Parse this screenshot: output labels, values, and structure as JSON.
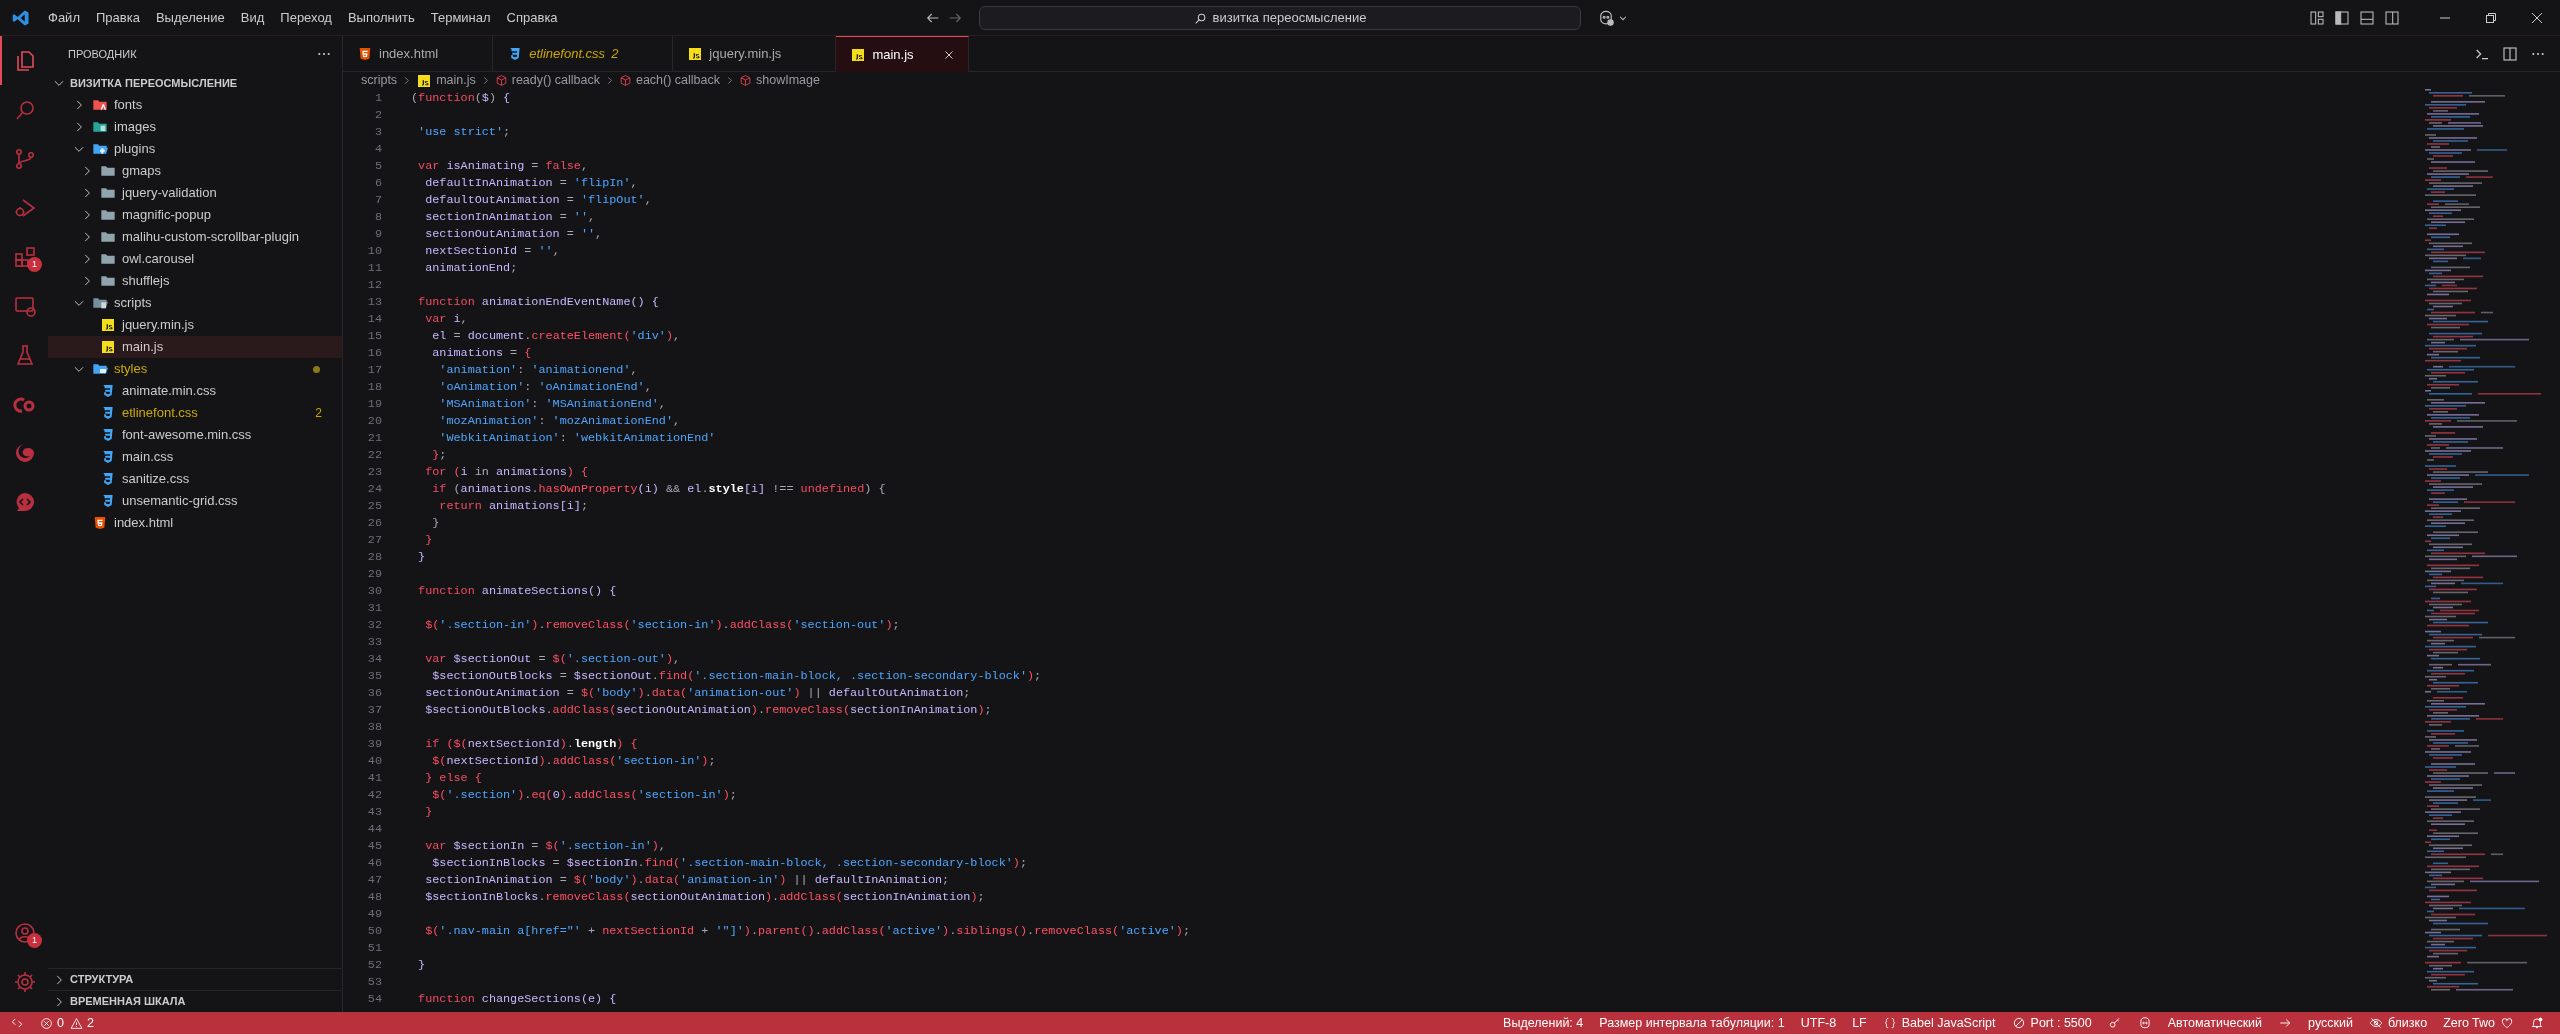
{
  "menu": [
    "Файл",
    "Правка",
    "Выделение",
    "Вид",
    "Переход",
    "Выполнить",
    "Терминал",
    "Справка"
  ],
  "search": {
    "value": "визитка переосмысление"
  },
  "activity_bar": [
    {
      "kind": "explorer",
      "selected": true
    },
    {
      "kind": "search",
      "selected": false
    },
    {
      "kind": "source-control",
      "selected": false
    },
    {
      "kind": "run-debug",
      "selected": false
    },
    {
      "kind": "extensions",
      "selected": false,
      "badge": "1"
    },
    {
      "kind": "remote",
      "selected": false
    },
    {
      "kind": "testing",
      "selected": false
    },
    {
      "kind": "cloud",
      "selected": false
    },
    {
      "kind": "edge",
      "selected": false
    },
    {
      "kind": "chat",
      "selected": false
    }
  ],
  "activity_bar_bottom": [
    {
      "kind": "account",
      "badge": "1"
    },
    {
      "kind": "settings"
    }
  ],
  "explorer": {
    "title": "ПРОВОДНИК",
    "root": {
      "label": "ВИЗИТКА ПЕРЕОСМЫСЛЕНИЕ",
      "expanded": true
    },
    "items": [
      {
        "label": "fonts",
        "kind": "folder-fonts",
        "expanded": false,
        "selected": false
      },
      {
        "label": "images",
        "kind": "folder-images",
        "expanded": false,
        "selected": false
      },
      {
        "label": "plugins",
        "kind": "folder-plugins",
        "expanded": true,
        "selected": false,
        "children": [
          {
            "label": "gmaps",
            "kind": "folder",
            "expanded": false,
            "selected": false
          },
          {
            "label": "jquery-validation",
            "kind": "folder",
            "expanded": false,
            "selected": false
          },
          {
            "label": "magnific-popup",
            "kind": "folder",
            "expanded": false,
            "selected": false
          },
          {
            "label": "malihu-custom-scrollbar-plugin",
            "kind": "folder",
            "expanded": false,
            "selected": false
          },
          {
            "label": "owl.carousel",
            "kind": "folder",
            "expanded": false,
            "selected": false
          },
          {
            "label": "shufflejs",
            "kind": "folder",
            "expanded": false,
            "selected": false
          }
        ]
      },
      {
        "label": "scripts",
        "kind": "folder-scripts",
        "expanded": true,
        "selected": false,
        "children": [
          {
            "label": "jquery.min.js",
            "kind": "js",
            "selected": false
          },
          {
            "label": "main.js",
            "kind": "js",
            "selected": true
          }
        ]
      },
      {
        "label": "styles",
        "kind": "folder-styles",
        "expanded": true,
        "selected": false,
        "warning": true,
        "children": [
          {
            "label": "animate.min.css",
            "kind": "css",
            "selected": false
          },
          {
            "label": "etlinefont.css",
            "kind": "css",
            "selected": false,
            "warning": true,
            "badge": "2"
          },
          {
            "label": "font-awesome.min.css",
            "kind": "css",
            "selected": false
          },
          {
            "label": "main.css",
            "kind": "css",
            "selected": false
          },
          {
            "label": "sanitize.css",
            "kind": "css",
            "selected": false
          },
          {
            "label": "unsemantic-grid.css",
            "kind": "css",
            "selected": false
          }
        ]
      },
      {
        "label": "index.html",
        "kind": "html",
        "selected": false
      }
    ]
  },
  "panels": [
    {
      "label": "СТРУКТУРА",
      "expanded": false
    },
    {
      "label": "ВРЕМЕННАЯ ШКАЛА",
      "expanded": false
    }
  ],
  "tabs": [
    {
      "label": "index.html",
      "kind": "html",
      "selected": false
    },
    {
      "label": "etlinefont.css",
      "kind": "css",
      "selected": false,
      "preview": true,
      "warning": true,
      "badge": "2"
    },
    {
      "label": "jquery.min.js",
      "kind": "js",
      "selected": false
    },
    {
      "label": "main.js",
      "kind": "js",
      "selected": true
    }
  ],
  "breadcrumbs": [
    {
      "label": "scripts",
      "kind": "folder"
    },
    {
      "label": "main.js",
      "kind": "js"
    },
    {
      "label": "ready() callback",
      "kind": "symbol"
    },
    {
      "label": "each() callback",
      "kind": "symbol"
    },
    {
      "label": "showImage",
      "kind": "symbol"
    }
  ],
  "code": [
    {
      "number": "1",
      "tokens": [
        {
          "text": "(",
          "kind": "p"
        },
        {
          "text": "function",
          "kind": "kw"
        },
        {
          "text": "(",
          "kind": "p"
        },
        {
          "text": "$",
          "kind": "id"
        },
        {
          "text": ")",
          "kind": "p"
        },
        {
          "text": " {",
          "kind": "br"
        }
      ]
    },
    {
      "number": "2"
    },
    {
      "number": "3",
      "tokens": [
        {
          "text": " 'use strict'",
          "kind": "str"
        },
        {
          "text": ";",
          "kind": "p"
        }
      ]
    },
    {
      "number": "4"
    },
    {
      "number": "5",
      "tokens": [
        {
          "text": " var",
          "kind": "kw"
        },
        {
          "text": " isAnimating",
          "kind": "id"
        },
        {
          "text": " =",
          "kind": "p"
        },
        {
          "text": " false",
          "kind": "lit"
        },
        {
          "text": ",",
          "kind": "p"
        }
      ]
    },
    {
      "number": "6",
      "tokens": [
        {
          "text": "  defaultInAnimation",
          "kind": "id"
        },
        {
          "text": " =",
          "kind": "p"
        },
        {
          "text": " 'flipIn'",
          "kind": "str"
        },
        {
          "text": ",",
          "kind": "p"
        }
      ]
    },
    {
      "number": "7",
      "tokens": [
        {
          "text": "  defaultOutAnimation",
          "kind": "id"
        },
        {
          "text": " =",
          "kind": "p"
        },
        {
          "text": " 'flipOut'",
          "kind": "str"
        },
        {
          "text": ",",
          "kind": "p"
        }
      ]
    },
    {
      "number": "8",
      "tokens": [
        {
          "text": "  sectionInAnimation",
          "kind": "id"
        },
        {
          "text": " =",
          "kind": "p"
        },
        {
          "text": " ''",
          "kind": "str"
        },
        {
          "text": ",",
          "kind": "p"
        }
      ]
    },
    {
      "number": "9",
      "tokens": [
        {
          "text": "  sectionOutAnimation",
          "kind": "id"
        },
        {
          "text": " =",
          "kind": "p"
        },
        {
          "text": " ''",
          "kind": "str"
        },
        {
          "text": ",",
          "kind": "p"
        }
      ]
    },
    {
      "number": "10",
      "tokens": [
        {
          "text": "  nextSectionId",
          "kind": "id"
        },
        {
          "text": " =",
          "kind": "p"
        },
        {
          "text": " ''",
          "kind": "str"
        },
        {
          "text": ",",
          "kind": "p"
        }
      ]
    },
    {
      "number": "11",
      "tokens": [
        {
          "text": "  animationEnd",
          "kind": "id"
        },
        {
          "text": ";",
          "kind": "p"
        }
      ]
    },
    {
      "number": "12"
    },
    {
      "number": "13",
      "tokens": [
        {
          "text": " function",
          "kind": "kw"
        },
        {
          "text": " animationEndEventName",
          "kind": "id"
        },
        {
          "text": "()",
          "kind": "br"
        },
        {
          "text": " {",
          "kind": "br"
        }
      ]
    },
    {
      "number": "14",
      "tokens": [
        {
          "text": "  var",
          "kind": "kw"
        },
        {
          "text": " i",
          "kind": "id"
        },
        {
          "text": ",",
          "kind": "p"
        }
      ]
    },
    {
      "number": "15",
      "tokens": [
        {
          "text": "   el",
          "kind": "id"
        },
        {
          "text": " =",
          "kind": "p"
        },
        {
          "text": " document",
          "kind": "id"
        },
        {
          "text": ".",
          "kind": "p"
        },
        {
          "text": "createElement",
          "kind": "fn"
        },
        {
          "text": "(",
          "kind": "fn"
        },
        {
          "text": "'div'",
          "kind": "str"
        },
        {
          "text": ")",
          "kind": "fn"
        },
        {
          "text": ",",
          "kind": "p"
        }
      ]
    },
    {
      "number": "16",
      "tokens": [
        {
          "text": "   animations",
          "kind": "id"
        },
        {
          "text": " =",
          "kind": "p"
        },
        {
          "text": " {",
          "kind": "fn"
        }
      ]
    },
    {
      "number": "17",
      "tokens": [
        {
          "text": "    'animation'",
          "kind": "str"
        },
        {
          "text": ":",
          "kind": "p"
        },
        {
          "text": " 'animationend'",
          "kind": "str"
        },
        {
          "text": ",",
          "kind": "p"
        }
      ]
    },
    {
      "number": "18",
      "tokens": [
        {
          "text": "    'oAnimation'",
          "kind": "str"
        },
        {
          "text": ":",
          "kind": "p"
        },
        {
          "text": " 'oAnimationEnd'",
          "kind": "str"
        },
        {
          "text": ",",
          "kind": "p"
        }
      ]
    },
    {
      "number": "19",
      "tokens": [
        {
          "text": "    'MSAnimation'",
          "kind": "str"
        },
        {
          "text": ":",
          "kind": "p"
        },
        {
          "text": " 'MSAnimationEnd'",
          "kind": "str"
        },
        {
          "text": ",",
          "kind": "p"
        }
      ]
    },
    {
      "number": "20",
      "tokens": [
        {
          "text": "    'mozAnimation'",
          "kind": "str"
        },
        {
          "text": ":",
          "kind": "p"
        },
        {
          "text": " 'mozAnimationEnd'",
          "kind": "str"
        },
        {
          "text": ",",
          "kind": "p"
        }
      ]
    },
    {
      "number": "21",
      "tokens": [
        {
          "text": "    'WebkitAnimation'",
          "kind": "str"
        },
        {
          "text": ":",
          "kind": "p"
        },
        {
          "text": " 'webkitAnimationEnd'",
          "kind": "str"
        }
      ]
    },
    {
      "number": "22",
      "tokens": [
        {
          "text": "   }",
          "kind": "fn"
        },
        {
          "text": ";",
          "kind": "p"
        }
      ]
    },
    {
      "number": "23",
      "tokens": [
        {
          "text": "  for",
          "kind": "kw"
        },
        {
          "text": " (",
          "kind": "fn"
        },
        {
          "text": "i",
          "kind": "id"
        },
        {
          "text": " in",
          "kind": "p"
        },
        {
          "text": " animations",
          "kind": "id"
        },
        {
          "text": ")",
          "kind": "fn"
        },
        {
          "text": " {",
          "kind": "fn"
        }
      ]
    },
    {
      "number": "24",
      "tokens": [
        {
          "text": "   if",
          "kind": "kw"
        },
        {
          "text": " (",
          "kind": "p"
        },
        {
          "text": "animations",
          "kind": "id"
        },
        {
          "text": ".",
          "kind": "p"
        },
        {
          "text": "hasOwnProperty",
          "kind": "fn"
        },
        {
          "text": "(",
          "kind": "br"
        },
        {
          "text": "i",
          "kind": "id"
        },
        {
          "text": ")",
          "kind": "br"
        },
        {
          "text": " &&",
          "kind": "p"
        },
        {
          "text": " el",
          "kind": "id"
        },
        {
          "text": ".",
          "kind": "p"
        },
        {
          "text": "style",
          "kind": "prop"
        },
        {
          "text": "[",
          "kind": "br"
        },
        {
          "text": "i",
          "kind": "id"
        },
        {
          "text": "]",
          "kind": "br"
        },
        {
          "text": " !==",
          "kind": "p"
        },
        {
          "text": " undefined",
          "kind": "lit"
        },
        {
          "text": ")",
          "kind": "p"
        },
        {
          "text": " {",
          "kind": "p"
        }
      ]
    },
    {
      "number": "25",
      "tokens": [
        {
          "text": "    return",
          "kind": "kw"
        },
        {
          "text": " animations",
          "kind": "id"
        },
        {
          "text": "[",
          "kind": "br"
        },
        {
          "text": "i",
          "kind": "id"
        },
        {
          "text": "]",
          "kind": "br"
        },
        {
          "text": ";",
          "kind": "p"
        }
      ]
    },
    {
      "number": "26",
      "tokens": [
        {
          "text": "   }",
          "kind": "p"
        }
      ]
    },
    {
      "number": "27",
      "tokens": [
        {
          "text": "  }",
          "kind": "fn"
        }
      ]
    },
    {
      "number": "28",
      "tokens": [
        {
          "text": " }",
          "kind": "br"
        }
      ]
    },
    {
      "number": "29"
    },
    {
      "number": "30",
      "tokens": [
        {
          "text": " function",
          "kind": "kw"
        },
        {
          "text": " animateSections",
          "kind": "id"
        },
        {
          "text": "()",
          "kind": "br"
        },
        {
          "text": " {",
          "kind": "br"
        }
      ]
    },
    {
      "number": "31"
    },
    {
      "number": "32",
      "tokens": [
        {
          "text": "  $(",
          "kind": "fn"
        },
        {
          "text": "'.section-in'",
          "kind": "str"
        },
        {
          "text": ")",
          "kind": "fn"
        },
        {
          "text": ".",
          "kind": "p"
        },
        {
          "text": "removeClass",
          "kind": "fn"
        },
        {
          "text": "(",
          "kind": "fn"
        },
        {
          "text": "'section-in'",
          "kind": "str"
        },
        {
          "text": ")",
          "kind": "fn"
        },
        {
          "text": ".",
          "kind": "p"
        },
        {
          "text": "addClass",
          "kind": "fn"
        },
        {
          "text": "(",
          "kind": "fn"
        },
        {
          "text": "'section-out'",
          "kind": "str"
        },
        {
          "text": ")",
          "kind": "fn"
        },
        {
          "text": ";",
          "kind": "p"
        }
      ]
    },
    {
      "number": "33"
    },
    {
      "number": "34",
      "tokens": [
        {
          "text": "  var",
          "kind": "kw"
        },
        {
          "text": " $sectionOut",
          "kind": "id"
        },
        {
          "text": " =",
          "kind": "p"
        },
        {
          "text": " $(",
          "kind": "fn"
        },
        {
          "text": "'.section-out'",
          "kind": "str"
        },
        {
          "text": ")",
          "kind": "fn"
        },
        {
          "text": ",",
          "kind": "p"
        }
      ]
    },
    {
      "number": "35",
      "tokens": [
        {
          "text": "   $sectionOutBlocks",
          "kind": "id"
        },
        {
          "text": " =",
          "kind": "p"
        },
        {
          "text": " $sectionOut",
          "kind": "id"
        },
        {
          "text": ".",
          "kind": "p"
        },
        {
          "text": "find",
          "kind": "fn"
        },
        {
          "text": "(",
          "kind": "fn"
        },
        {
          "text": "'.section-main-block, .section-secondary-block'",
          "kind": "str"
        },
        {
          "text": ")",
          "kind": "fn"
        },
        {
          "text": ";",
          "kind": "p"
        }
      ]
    },
    {
      "number": "36",
      "tokens": [
        {
          "text": "  sectionOutAnimation",
          "kind": "id"
        },
        {
          "text": " =",
          "kind": "p"
        },
        {
          "text": " $(",
          "kind": "fn"
        },
        {
          "text": "'body'",
          "kind": "str"
        },
        {
          "text": ")",
          "kind": "fn"
        },
        {
          "text": ".",
          "kind": "p"
        },
        {
          "text": "data",
          "kind": "fn"
        },
        {
          "text": "(",
          "kind": "fn"
        },
        {
          "text": "'animation-out'",
          "kind": "str"
        },
        {
          "text": ")",
          "kind": "fn"
        },
        {
          "text": " ||",
          "kind": "p"
        },
        {
          "text": " defaultOutAnimation",
          "kind": "id"
        },
        {
          "text": ";",
          "kind": "p"
        }
      ]
    },
    {
      "number": "37",
      "tokens": [
        {
          "text": "  $sectionOutBlocks",
          "kind": "id"
        },
        {
          "text": ".",
          "kind": "p"
        },
        {
          "text": "addClass",
          "kind": "fn"
        },
        {
          "text": "(",
          "kind": "fn"
        },
        {
          "text": "sectionOutAnimation",
          "kind": "id"
        },
        {
          "text": ")",
          "kind": "fn"
        },
        {
          "text": ".",
          "kind": "p"
        },
        {
          "text": "removeClass",
          "kind": "fn"
        },
        {
          "text": "(",
          "kind": "fn"
        },
        {
          "text": "sectionInAnimation",
          "kind": "id"
        },
        {
          "text": ")",
          "kind": "fn"
        },
        {
          "text": ";",
          "kind": "p"
        }
      ]
    },
    {
      "number": "38"
    },
    {
      "number": "39",
      "tokens": [
        {
          "text": "  if",
          "kind": "kw"
        },
        {
          "text": " ($(",
          "kind": "fn"
        },
        {
          "text": "nextSectionId",
          "kind": "id"
        },
        {
          "text": ")",
          "kind": "fn"
        },
        {
          "text": ".",
          "kind": "p"
        },
        {
          "text": "length",
          "kind": "prop"
        },
        {
          "text": ")",
          "kind": "fn"
        },
        {
          "text": " {",
          "kind": "fn"
        }
      ]
    },
    {
      "number": "40",
      "tokens": [
        {
          "text": "   $(",
          "kind": "fn"
        },
        {
          "text": "nextSectionId",
          "kind": "id"
        },
        {
          "text": ")",
          "kind": "fn"
        },
        {
          "text": ".",
          "kind": "p"
        },
        {
          "text": "addClass",
          "kind": "fn"
        },
        {
          "text": "(",
          "kind": "fn"
        },
        {
          "text": "'section-in'",
          "kind": "str"
        },
        {
          "text": ")",
          "kind": "fn"
        },
        {
          "text": ";",
          "kind": "p"
        }
      ]
    },
    {
      "number": "41",
      "tokens": [
        {
          "text": "  }",
          "kind": "fn"
        },
        {
          "text": " else",
          "kind": "kw"
        },
        {
          "text": " {",
          "kind": "fn"
        }
      ]
    },
    {
      "number": "42",
      "tokens": [
        {
          "text": "   $(",
          "kind": "fn"
        },
        {
          "text": "'.section'",
          "kind": "str"
        },
        {
          "text": ")",
          "kind": "fn"
        },
        {
          "text": ".",
          "kind": "p"
        },
        {
          "text": "eq",
          "kind": "fn"
        },
        {
          "text": "(",
          "kind": "fn"
        },
        {
          "text": "0",
          "kind": "id"
        },
        {
          "text": ")",
          "kind": "fn"
        },
        {
          "text": ".",
          "kind": "p"
        },
        {
          "text": "addClass",
          "kind": "fn"
        },
        {
          "text": "(",
          "kind": "fn"
        },
        {
          "text": "'section-in'",
          "kind": "str"
        },
        {
          "text": ")",
          "kind": "fn"
        },
        {
          "text": ";",
          "kind": "p"
        }
      ]
    },
    {
      "number": "43",
      "tokens": [
        {
          "text": "  }",
          "kind": "fn"
        }
      ]
    },
    {
      "number": "44"
    },
    {
      "number": "45",
      "tokens": [
        {
          "text": "  var",
          "kind": "kw"
        },
        {
          "text": " $sectionIn",
          "kind": "id"
        },
        {
          "text": " =",
          "kind": "p"
        },
        {
          "text": " $(",
          "kind": "fn"
        },
        {
          "text": "'.section-in'",
          "kind": "str"
        },
        {
          "text": ")",
          "kind": "fn"
        },
        {
          "text": ",",
          "kind": "p"
        }
      ]
    },
    {
      "number": "46",
      "tokens": [
        {
          "text": "   $sectionInBlocks",
          "kind": "id"
        },
        {
          "text": " =",
          "kind": "p"
        },
        {
          "text": " $sectionIn",
          "kind": "id"
        },
        {
          "text": ".",
          "kind": "p"
        },
        {
          "text": "find",
          "kind": "fn"
        },
        {
          "text": "(",
          "kind": "fn"
        },
        {
          "text": "'.section-main-block, .section-secondary-block'",
          "kind": "str"
        },
        {
          "text": ")",
          "kind": "fn"
        },
        {
          "text": ";",
          "kind": "p"
        }
      ]
    },
    {
      "number": "47",
      "tokens": [
        {
          "text": "  sectionInAnimation",
          "kind": "id"
        },
        {
          "text": " =",
          "kind": "p"
        },
        {
          "text": " $(",
          "kind": "fn"
        },
        {
          "text": "'body'",
          "kind": "str"
        },
        {
          "text": ")",
          "kind": "fn"
        },
        {
          "text": ".",
          "kind": "p"
        },
        {
          "text": "data",
          "kind": "fn"
        },
        {
          "text": "(",
          "kind": "fn"
        },
        {
          "text": "'animation-in'",
          "kind": "str"
        },
        {
          "text": ")",
          "kind": "fn"
        },
        {
          "text": " ||",
          "kind": "p"
        },
        {
          "text": " defaultInAnimation",
          "kind": "id"
        },
        {
          "text": ";",
          "kind": "p"
        }
      ]
    },
    {
      "number": "48",
      "tokens": [
        {
          "text": "  $sectionInBlocks",
          "kind": "id"
        },
        {
          "text": ".",
          "kind": "p"
        },
        {
          "text": "removeClass",
          "kind": "fn"
        },
        {
          "text": "(",
          "kind": "fn"
        },
        {
          "text": "sectionOutAnimation",
          "kind": "id"
        },
        {
          "text": ")",
          "kind": "fn"
        },
        {
          "text": ".",
          "kind": "p"
        },
        {
          "text": "addClass",
          "kind": "fn"
        },
        {
          "text": "(",
          "kind": "fn"
        },
        {
          "text": "sectionInAnimation",
          "kind": "id"
        },
        {
          "text": ")",
          "kind": "fn"
        },
        {
          "text": ";",
          "kind": "p"
        }
      ]
    },
    {
      "number": "49"
    },
    {
      "number": "50",
      "tokens": [
        {
          "text": "  $(",
          "kind": "fn"
        },
        {
          "text": "'.nav-main a[href=\"'",
          "kind": "str"
        },
        {
          "text": " +",
          "kind": "p"
        },
        {
          "text": " nextSectionId",
          "kind": "fn"
        },
        {
          "text": " +",
          "kind": "p"
        },
        {
          "text": " '\"]'",
          "kind": "str"
        },
        {
          "text": ")",
          "kind": "fn"
        },
        {
          "text": ".",
          "kind": "p"
        },
        {
          "text": "parent",
          "kind": "fn"
        },
        {
          "text": "()",
          "kind": "fn"
        },
        {
          "text": ".",
          "kind": "p"
        },
        {
          "text": "addClass",
          "kind": "fn"
        },
        {
          "text": "(",
          "kind": "fn"
        },
        {
          "text": "'active'",
          "kind": "str"
        },
        {
          "text": ")",
          "kind": "fn"
        },
        {
          "text": ".",
          "kind": "p"
        },
        {
          "text": "siblings",
          "kind": "fn"
        },
        {
          "text": "()",
          "kind": "fn"
        },
        {
          "text": ".",
          "kind": "p"
        },
        {
          "text": "removeClass",
          "kind": "fn"
        },
        {
          "text": "(",
          "kind": "fn"
        },
        {
          "text": "'active'",
          "kind": "str"
        },
        {
          "text": ")",
          "kind": "fn"
        },
        {
          "text": ";",
          "kind": "p"
        }
      ]
    },
    {
      "number": "51"
    },
    {
      "number": "52",
      "tokens": [
        {
          "text": " }",
          "kind": "br"
        }
      ]
    },
    {
      "number": "53"
    },
    {
      "number": "54",
      "tokens": [
        {
          "text": " function",
          "kind": "kw"
        },
        {
          "text": " changeSections",
          "kind": "id"
        },
        {
          "text": "(",
          "kind": "br"
        },
        {
          "text": "e",
          "kind": "id"
        },
        {
          "text": ")",
          "kind": "br"
        },
        {
          "text": " {",
          "kind": "br"
        }
      ]
    }
  ],
  "status_bar": {
    "left": [
      {
        "kind": "remote"
      },
      {
        "kind": "problems",
        "errors": "0",
        "warnings": "2"
      }
    ],
    "right": [
      {
        "kind": "text",
        "text": "Выделений: 4"
      },
      {
        "kind": "text",
        "text": "Размер интервала табуляции: 1"
      },
      {
        "kind": "text",
        "text": "UTF-8"
      },
      {
        "kind": "text",
        "text": "LF"
      },
      {
        "kind": "language",
        "text": "Babel JavaScript"
      },
      {
        "kind": "port",
        "text": "Port : 5500"
      },
      {
        "kind": "key"
      },
      {
        "kind": "copilot"
      },
      {
        "kind": "text",
        "text": "Автоматический"
      },
      {
        "kind": "arrow"
      },
      {
        "kind": "text",
        "text": "русский"
      },
      {
        "kind": "hidden",
        "text": "близко"
      },
      {
        "kind": "heart",
        "text": "Zero Two"
      },
      {
        "kind": "bell"
      }
    ]
  }
}
